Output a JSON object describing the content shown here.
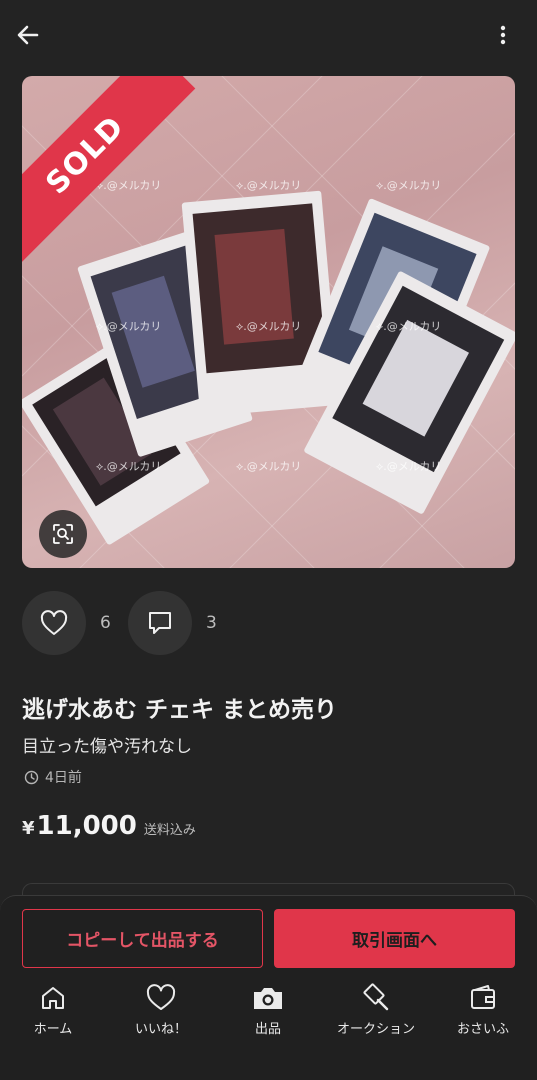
{
  "listing": {
    "sold_label": "SOLD",
    "watermark": "⟡.@メルカリ",
    "likes_count": "6",
    "comments_count": "3",
    "title": "逃げ水あむ チェキ まとめ売り",
    "condition": "目立った傷や汚れなし",
    "posted": "4日前",
    "price_currency": "¥",
    "price": "11,000",
    "shipping": "送料込み"
  },
  "actions": {
    "copy_label": "コピーして出品する",
    "trade_label": "取引画面へ"
  },
  "nav": {
    "items": [
      {
        "label": "ホーム",
        "icon": "home-icon"
      },
      {
        "label": "いいね！",
        "icon": "heart-icon"
      },
      {
        "label": "出品",
        "icon": "camera-icon"
      },
      {
        "label": "オークション",
        "icon": "gavel-icon"
      },
      {
        "label": "おさいふ",
        "icon": "wallet-icon"
      }
    ]
  },
  "colors": {
    "accent": "#e0364a",
    "background": "#232323"
  }
}
